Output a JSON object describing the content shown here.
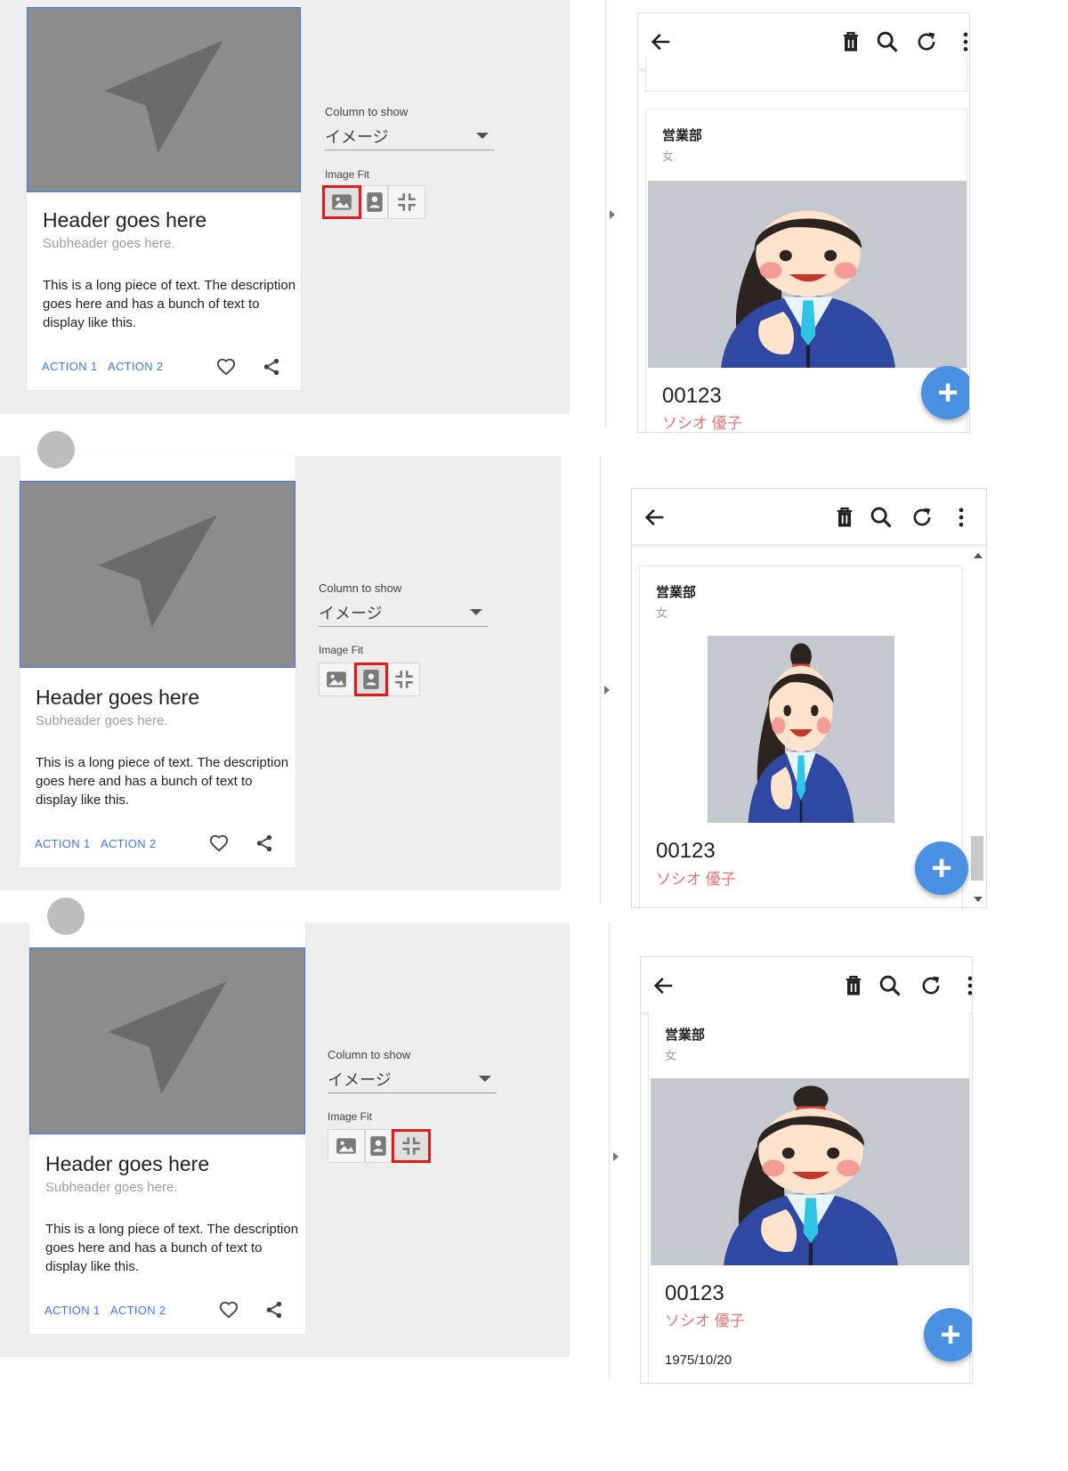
{
  "card_preview": {
    "header": "Header goes here",
    "subheader": "Subheader goes here.",
    "description": "This is a long piece of text. The description goes here and has a bunch of text to display like this.",
    "action1": "ACTION 1",
    "action2": "ACTION 2"
  },
  "settings": {
    "column_label": "Column to show",
    "column_value": "イメージ",
    "image_fit_label": "Image Fit"
  },
  "record": {
    "department": "営業部",
    "gender": "女",
    "employee_id": "00123",
    "name": "ソシオ 優子",
    "birth_date": "1975/10/20"
  },
  "panels": [
    {
      "selected_fit": "fill"
    },
    {
      "selected_fit": "contain"
    },
    {
      "selected_fit": "cover"
    }
  ],
  "colors": {
    "accent": "#3b78e7",
    "highlight": "#e11a1a",
    "fab": "#4a90e2",
    "name": "#e57373"
  },
  "icons": {
    "fit_fill": "image-icon",
    "fit_contain": "portrait-icon",
    "fit_cover": "shrink-icon",
    "back": "arrow-left-icon",
    "delete": "trash-icon",
    "search": "search-icon",
    "refresh": "refresh-icon",
    "more": "more-vert-icon",
    "add": "plus-icon",
    "favorite": "heart-icon",
    "share": "share-icon"
  }
}
